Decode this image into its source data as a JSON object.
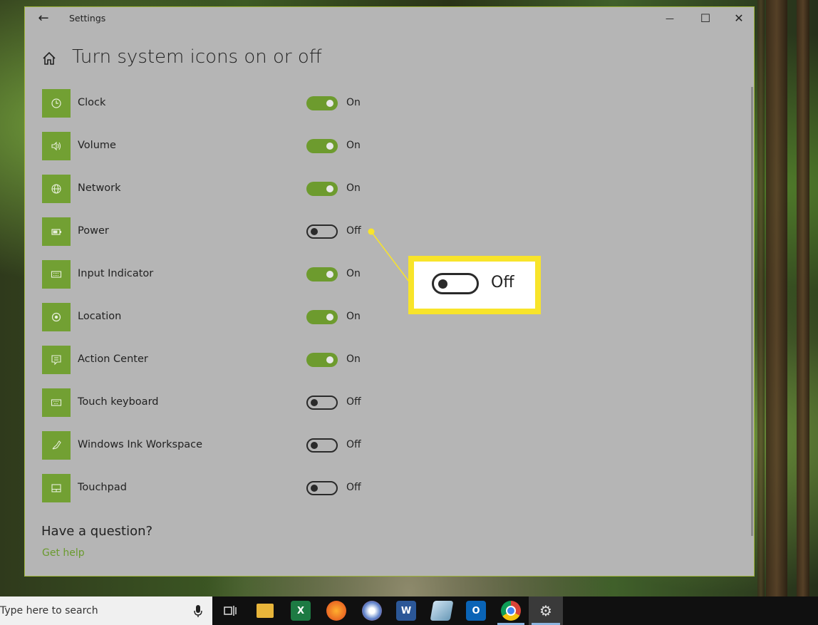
{
  "window": {
    "app_title": "Settings",
    "back_glyph": "←",
    "minimize_glyph": "—",
    "maximize_glyph": "☐",
    "close_glyph": "✕"
  },
  "page": {
    "title": "Turn system icons on or off"
  },
  "items": [
    {
      "label": "Clock",
      "state": "On",
      "on": true,
      "icon": "clock-icon"
    },
    {
      "label": "Volume",
      "state": "On",
      "on": true,
      "icon": "volume-icon"
    },
    {
      "label": "Network",
      "state": "On",
      "on": true,
      "icon": "network-icon"
    },
    {
      "label": "Power",
      "state": "Off",
      "on": false,
      "icon": "power-icon"
    },
    {
      "label": "Input Indicator",
      "state": "On",
      "on": true,
      "icon": "keyboard-icon"
    },
    {
      "label": "Location",
      "state": "On",
      "on": true,
      "icon": "location-icon"
    },
    {
      "label": "Action Center",
      "state": "On",
      "on": true,
      "icon": "action-center-icon"
    },
    {
      "label": "Touch keyboard",
      "state": "Off",
      "on": false,
      "icon": "touch-keyboard-icon"
    },
    {
      "label": "Windows Ink Workspace",
      "state": "Off",
      "on": false,
      "icon": "pen-icon"
    },
    {
      "label": "Touchpad",
      "state": "Off",
      "on": false,
      "icon": "touchpad-icon"
    }
  ],
  "help": {
    "question": "Have a question?",
    "link": "Get help"
  },
  "callout": {
    "state": "Off"
  },
  "taskbar": {
    "search_text": "Type here to search",
    "apps": [
      "task-view",
      "file-explorer",
      "excel",
      "firefox",
      "paint",
      "word",
      "notes",
      "outlook",
      "chrome",
      "settings"
    ]
  },
  "colors": {
    "accent_green": "#72a033",
    "toggle_on": "#6d9b2e",
    "callout_yellow": "#f8e42a",
    "window_bg": "#b5b5b5"
  }
}
